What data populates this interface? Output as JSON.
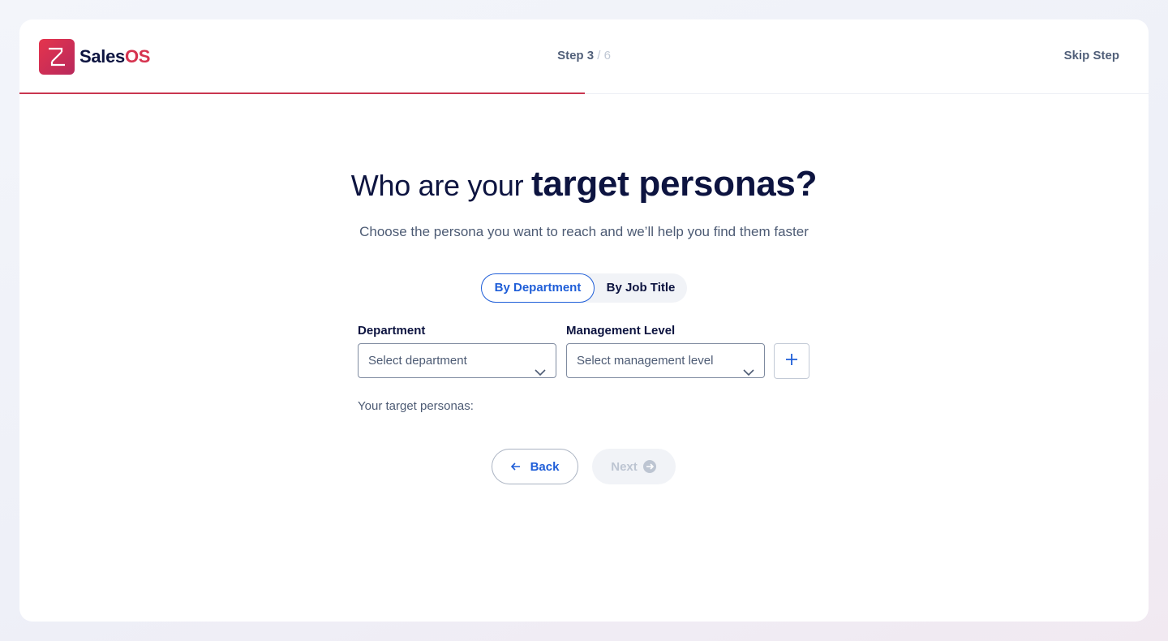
{
  "brand": {
    "name_part1": "Sales",
    "name_part2": "OS",
    "accent": "#d6334f"
  },
  "header": {
    "step_label": "Step 3",
    "step_separator": "/",
    "step_total": "6",
    "skip_label": "Skip Step",
    "progress_fraction": 0.5
  },
  "main": {
    "title_regular": "Who are your ",
    "title_bold": "target personas?",
    "subtitle": "Choose the persona you want to reach and we’ll help you find them faster",
    "tabs": [
      {
        "label": "By Department",
        "active": true
      },
      {
        "label": "By Job Title",
        "active": false
      }
    ],
    "department": {
      "label": "Department",
      "placeholder": "Select department"
    },
    "management": {
      "label": "Management Level",
      "placeholder": "Select management level"
    },
    "add_icon": "plus-icon",
    "personas_label": "Your target personas:",
    "back_label": "Back",
    "next_label": "Next"
  },
  "colors": {
    "primary": "#1f5ed8",
    "text_dark": "#0d1440",
    "progress": "#c9364f"
  }
}
